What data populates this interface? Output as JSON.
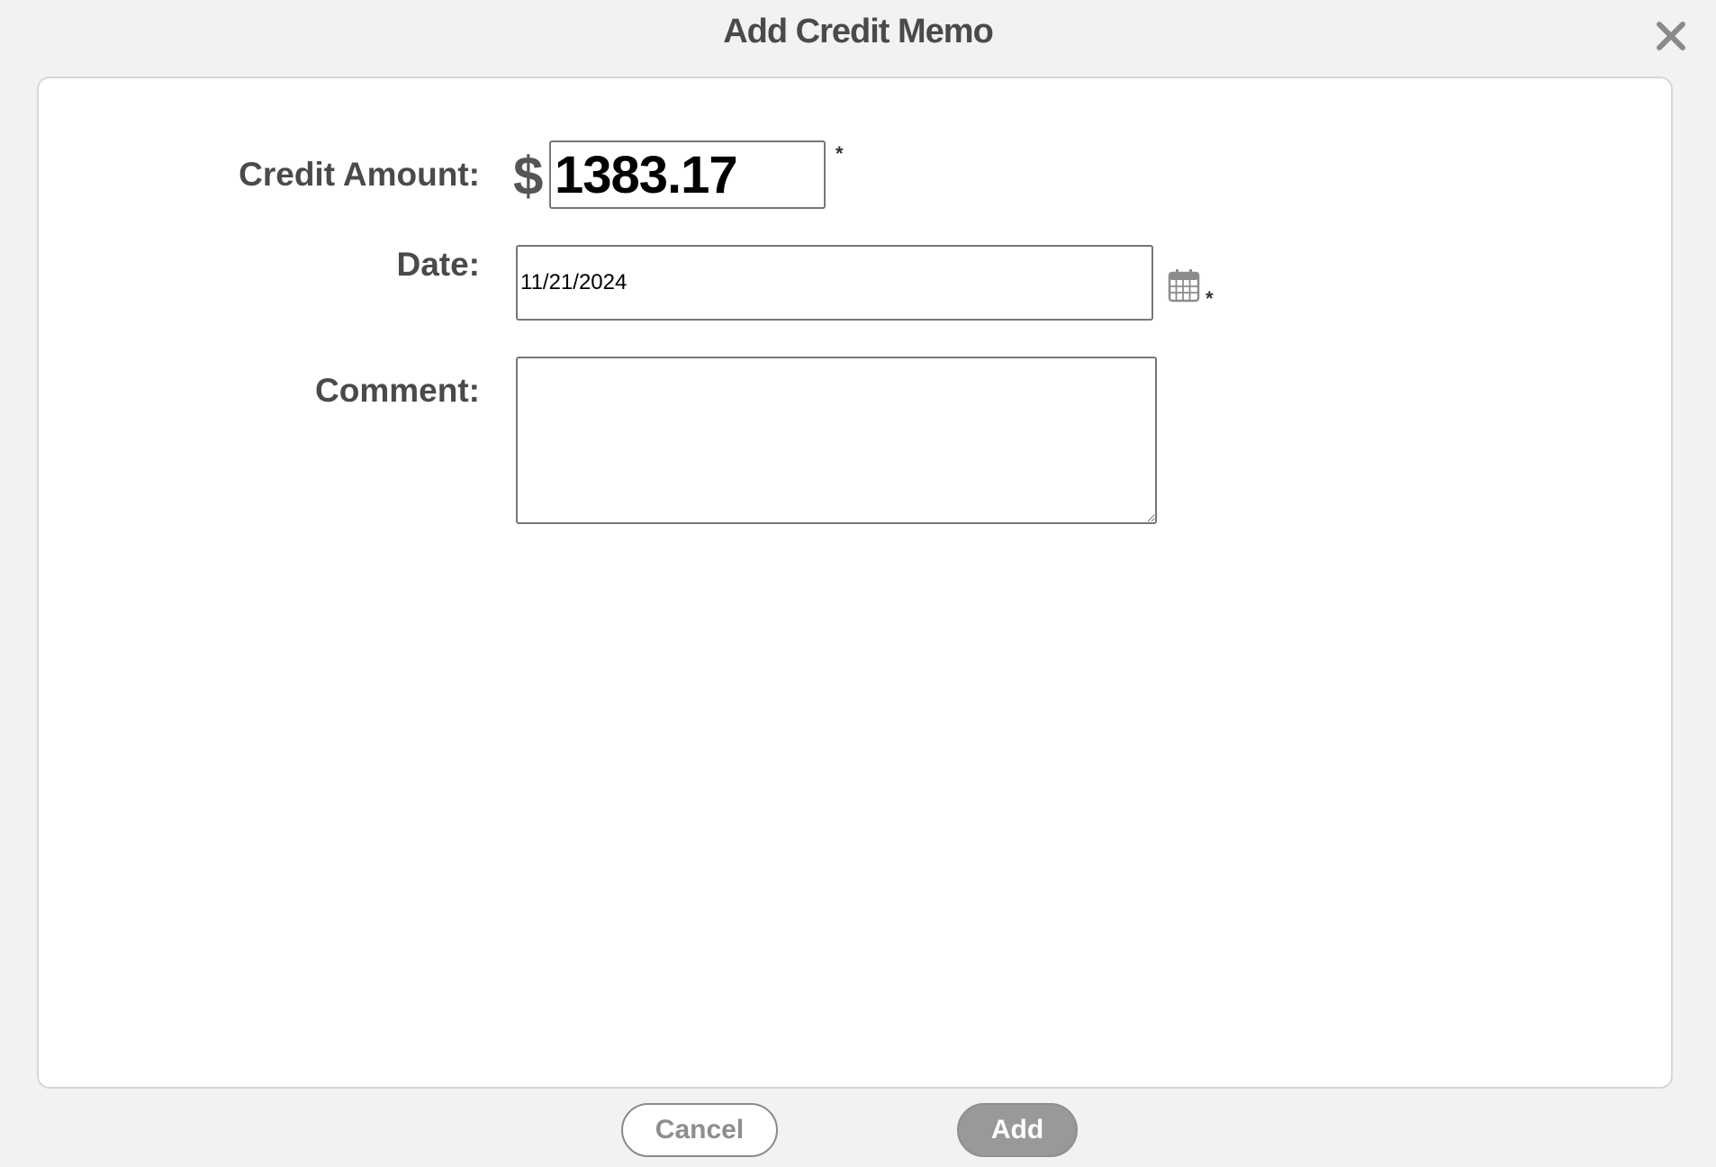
{
  "dialog": {
    "title": "Add Credit Memo"
  },
  "form": {
    "credit_amount": {
      "label": "Credit Amount:",
      "currency_symbol": "$",
      "value": "1383.17",
      "required_marker": "*"
    },
    "date": {
      "label": "Date:",
      "value": "11/21/2024",
      "required_marker": "*"
    },
    "comment": {
      "label": "Comment:",
      "value": ""
    }
  },
  "buttons": {
    "cancel_label": "Cancel",
    "add_label": "Add"
  },
  "icons": {
    "close": "close-icon",
    "calendar": "calendar-icon"
  },
  "colors": {
    "background": "#f2f2f2",
    "panel": "#ffffff",
    "label_text": "#4a4a4a",
    "add_button": "#999999",
    "cancel_text": "#8e8e8e"
  }
}
